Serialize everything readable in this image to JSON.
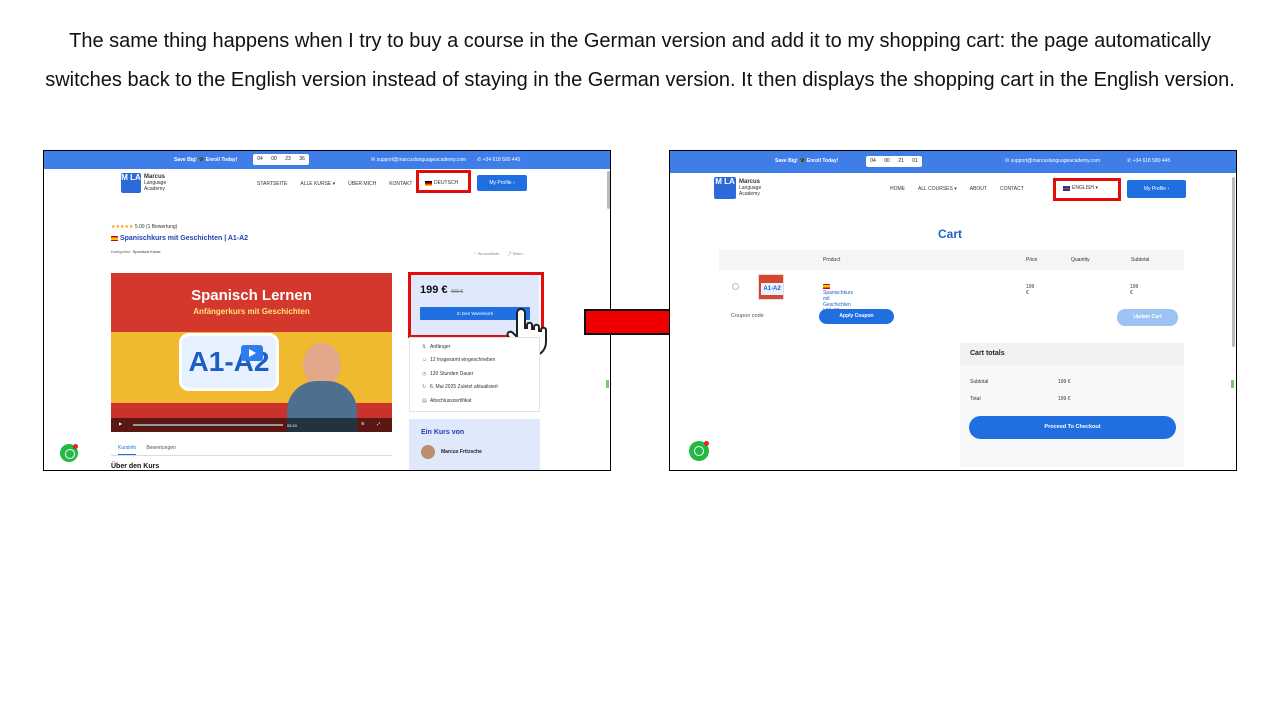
{
  "caption": "The same thing happens when I try to buy a course in the German version and add it to my shopping cart: the page automatically switches back to the English version instead of staying in the German version. It then displays the shopping cart in the English version.",
  "left": {
    "topbar": {
      "promo": "Save Big! 🎓 Enroll Today!",
      "timer": [
        "04",
        "00",
        "23",
        "36"
      ],
      "email": "✉ support@marcuslanguageacademy.com",
      "phone": "✆ +34 618 580 445"
    },
    "logo": {
      "mark": "M LA",
      "name": "Marcus",
      "line2": "Language",
      "line3": "Academy"
    },
    "nav": [
      "STARTSEITE",
      "ALLE KURSE ▾",
      "ÜBER MICH",
      "KONTAKT"
    ],
    "lang": "DEUTSCH",
    "profile": "My Profile ›",
    "rating": {
      "stars": "★★★★★",
      "score": "5.00",
      "count": "(1 Bewertung)"
    },
    "course_title": "Spanischkurs mit Geschichten | A1-A2",
    "category_label": "Kategorien:",
    "category": "Spanisch Kurse",
    "wishlist": "Wunschliste",
    "share": "Teilen",
    "video": {
      "title": "Spanisch Lernen",
      "subtitle": "Anfängerkurs mit Geschichten",
      "level": "A1-A2",
      "time": "05:20"
    },
    "price": "199 €",
    "old_price": "499 €",
    "cart_button": "In Den Warenkorb",
    "meta": [
      {
        "icon": "level-icon",
        "text": "Anfänger"
      },
      {
        "icon": "students-icon",
        "text": "12 Insgesamt eingeschrieben"
      },
      {
        "icon": "clock-icon",
        "text": "120 Stunden Dauer"
      },
      {
        "icon": "refresh-icon",
        "text": "6. Mai 2025 Zuletzt aktualisiert"
      },
      {
        "icon": "certificate-icon",
        "text": "Abschlusszertifikat"
      }
    ],
    "instructor": {
      "heading": "Ein Kurs von",
      "name": "Marcus Fritzsche"
    },
    "tabs": [
      "Kursinfo",
      "Bewertungen"
    ],
    "section": "Über den Kurs"
  },
  "right": {
    "topbar": {
      "promo": "Save Big! 🎓 Enroll Today!",
      "timer": [
        "04",
        "00",
        "21",
        "01"
      ],
      "email": "✉ support@marcuslanguageacademy.com",
      "phone": "✆ +34 618 580 445"
    },
    "logo": {
      "mark": "M LA",
      "name": "Marcus",
      "line2": "Language",
      "line3": "Academy"
    },
    "nav": [
      "HOME",
      "ALL COURSES ▾",
      "ABOUT",
      "CONTACT"
    ],
    "lang": "ENGLISH ▾",
    "profile": "My Profile ›",
    "cart_title": "Cart",
    "table_headers": {
      "product": "Product",
      "price": "Price",
      "quantity": "Quantity",
      "subtotal": "Subtotal"
    },
    "row": {
      "product": "Spanischkurs mit Geschichten | A1-A2",
      "price": "199 €",
      "subtotal": "199 €",
      "thumb": "A1-A2"
    },
    "coupon_label": "Coupon code",
    "apply_coupon": "Apply Coupon",
    "update_cart": "Update Cart",
    "totals": {
      "heading": "Cart totals",
      "subtotal_label": "Subtotal",
      "subtotal": "199 €",
      "total_label": "Total",
      "total": "199 €"
    },
    "checkout": "Proceed To Checkout"
  },
  "colors": {
    "accent": "#1f6fe0",
    "highlight": "#e40b0b",
    "arrow": "#ee0000"
  }
}
